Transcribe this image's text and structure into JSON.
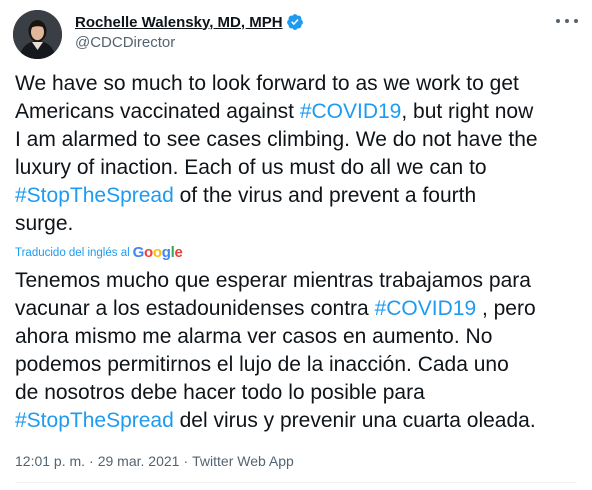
{
  "author": {
    "display_name": "Rochelle Walensky, MD, MPH",
    "handle": "@CDCDirector",
    "verified": true,
    "avatar_icon": "profile-photo"
  },
  "more_icon": "more-horizontal-icon",
  "tweet": {
    "original_lines": [
      [
        {
          "t": "We have so much to look forward to as we work to get"
        }
      ],
      [
        {
          "t": "Americans vaccinated against "
        },
        {
          "t": "#COVID19",
          "tag": true
        },
        {
          "t": ", but right now"
        }
      ],
      [
        {
          "t": "I am alarmed to see cases climbing. We do not have the"
        }
      ],
      [
        {
          "t": "luxury of inaction. Each of us must do all we can to"
        }
      ],
      [
        {
          "t": "#StopTheSpread",
          "tag": true
        },
        {
          "t": " of the virus and prevent a fourth"
        }
      ],
      [
        {
          "t": "surge."
        }
      ]
    ],
    "translated_by_label": "Traducido del inglés al",
    "translator_brand": "Google",
    "translated_lines": [
      [
        {
          "t": "Tenemos mucho que esperar mientras trabajamos para"
        }
      ],
      [
        {
          "t": "vacunar a los estadounidenses contra "
        },
        {
          "t": "#COVID19",
          "tag": true
        },
        {
          "t": " , pero"
        }
      ],
      [
        {
          "t": "ahora mismo me alarma ver casos en aumento. No"
        }
      ],
      [
        {
          "t": "podemos permitirnos el lujo de la inacción. Cada uno"
        }
      ],
      [
        {
          "t": "de nosotros debe hacer todo lo posible para"
        }
      ],
      [
        {
          "t": "#StopTheSpread",
          "tag": true
        },
        {
          "t": " del virus y prevenir una cuarta oleada."
        }
      ]
    ]
  },
  "meta": {
    "time": "12:01 p. m.",
    "separator": "·",
    "date": "29 mar. 2021",
    "source": "Twitter Web App"
  },
  "colors": {
    "link": "#1d9bf0",
    "text": "#0f1419",
    "muted": "#536471"
  }
}
